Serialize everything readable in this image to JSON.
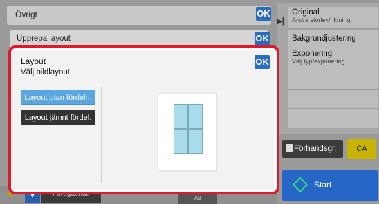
{
  "background": {
    "section_label": "Övrigt",
    "repeat_layout_label": "Upprepa layout",
    "ok_label": "OK"
  },
  "right_panel": {
    "items": [
      {
        "title": "Original",
        "subtitle": "Ändra storlek/riktning."
      },
      {
        "title": "Bakgrundjustering",
        "subtitle": ""
      },
      {
        "title": "Exponering",
        "subtitle": "Välj typ/exponering"
      }
    ],
    "preview_label": "Förhandsgr.",
    "ca_label": "CA",
    "start_label": "Start"
  },
  "bottom": {
    "previous_label": "Föregående",
    "paper_label": "A3"
  },
  "modal": {
    "title": "Layout",
    "subtitle": "Välj bildlayout",
    "ok_label": "OK",
    "options": [
      {
        "label": "Layout utan fördeln.",
        "selected": true
      },
      {
        "label": "Layout jämnt fördel.",
        "selected": false
      }
    ]
  },
  "colors": {
    "highlight": "#e2192b",
    "accent": "#2a6cc0",
    "selected_option": "#5aa6e0"
  }
}
